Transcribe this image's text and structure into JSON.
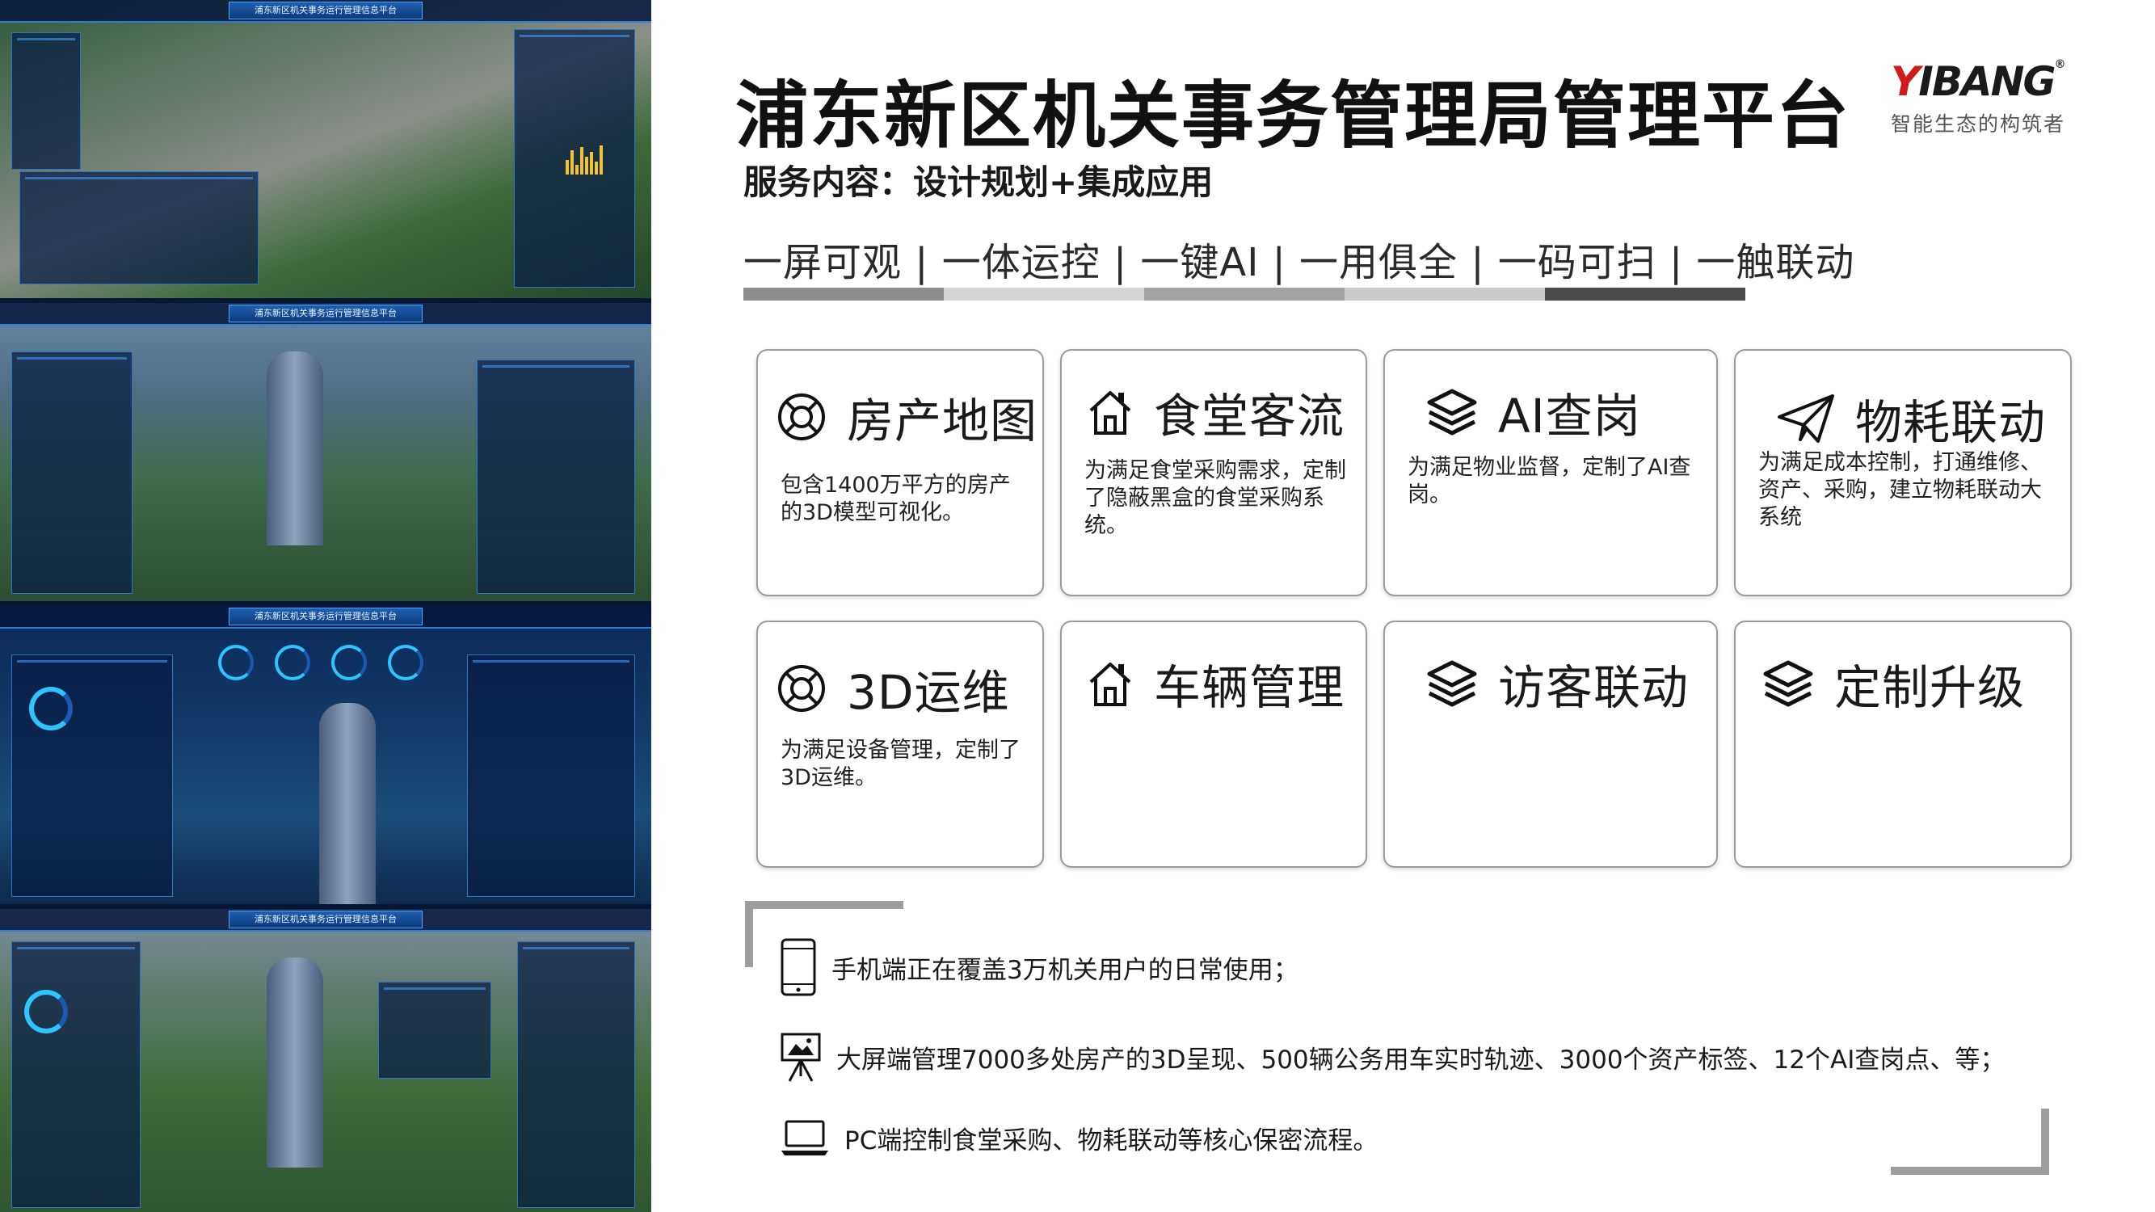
{
  "header": {
    "title": "浦东新区机关事务管理局管理平台",
    "subtitle": "服务内容：设计规划+集成应用"
  },
  "logo": {
    "mark_red": "Y",
    "mark_rest": "IBANG",
    "registered": "®",
    "tagline": "智能生态的构筑者"
  },
  "slogan": {
    "text": "一屏可观 | 一体运控 | 一键AI | 一用俱全 | 一码可扫 | 一触联动",
    "bar_colors": [
      "#8c8c8c",
      "#d4d4d4",
      "#a3a3a3",
      "#c9c9c9",
      "#4a4a4a"
    ]
  },
  "screens": {
    "banner": "浦东新区机关事务运行管理信息平台"
  },
  "features": [
    {
      "icon": "lifebuoy-icon",
      "name": "房产地图",
      "desc": "包含1400万平方的房产的3D模型可视化。"
    },
    {
      "icon": "house-icon",
      "name": "食堂客流",
      "desc": "为满足食堂采购需求，定制了隐蔽黑盒的食堂采购系统。"
    },
    {
      "icon": "layers-icon",
      "name": "AI查岗",
      "desc": "为满足物业监督，定制了AI查岗。"
    },
    {
      "icon": "paper-plane-icon",
      "name": "物耗联动",
      "desc": "为满足成本控制，打通维修、资产、采购，建立物耗联动大系统"
    },
    {
      "icon": "lifebuoy-icon",
      "name": "3D运维",
      "desc": "为满足设备管理，定制了3D运维。"
    },
    {
      "icon": "house-icon",
      "name": "车辆管理",
      "desc": ""
    },
    {
      "icon": "layers-icon",
      "name": "访客联动",
      "desc": ""
    },
    {
      "icon": "layers-icon",
      "name": "定制升级",
      "desc": ""
    }
  ],
  "info": [
    {
      "icon": "mobile-phone-icon",
      "text": "手机端正在覆盖3万机关用户的日常使用；"
    },
    {
      "icon": "presentation-screen-icon",
      "text": "大屏端管理7000多处房产的3D呈现、500辆公务用车实时轨迹、3000个资产标签、12个AI查岗点、等；"
    },
    {
      "icon": "laptop-icon",
      "text": "PC端控制食堂采购、物耗联动等核心保密流程。"
    }
  ]
}
